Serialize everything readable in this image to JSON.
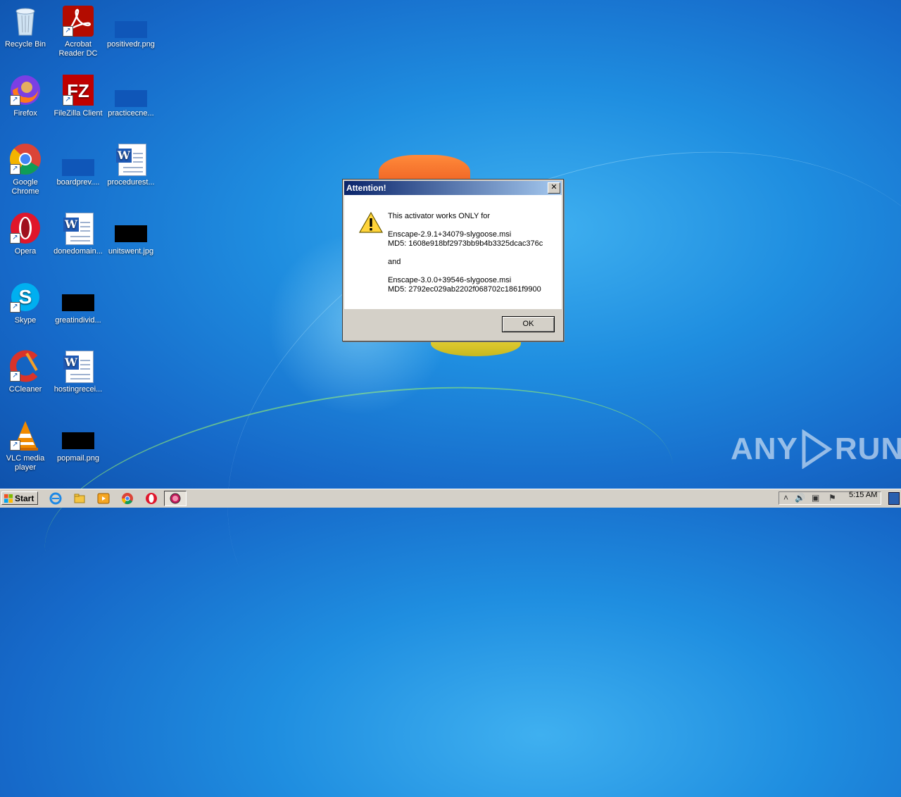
{
  "desktop": {
    "icons": [
      {
        "label": "Recycle Bin"
      },
      {
        "label": "Acrobat Reader DC"
      },
      {
        "label": "positivedr.png"
      },
      {
        "label": "Firefox"
      },
      {
        "label": "FileZilla Client"
      },
      {
        "label": "practicecne..."
      },
      {
        "label": "Google Chrome"
      },
      {
        "label": "boardprev...."
      },
      {
        "label": "procedurest..."
      },
      {
        "label": "Opera"
      },
      {
        "label": "donedomain..."
      },
      {
        "label": "unitswent.jpg"
      },
      {
        "label": "Skype"
      },
      {
        "label": "greatindivid..."
      },
      {
        "label": "CCleaner"
      },
      {
        "label": "hostingrecei..."
      },
      {
        "label": "VLC media player"
      },
      {
        "label": "popmail.png"
      }
    ]
  },
  "dialog": {
    "title": "Attention!",
    "close_label": "✕",
    "message": "This activator works ONLY for\n\nEnscape-2.9.1+34079-slygoose.msi\nMD5: 1608e918bf2973bb9b4b3325dcac376c\n\nand\n\nEnscape-3.0.0+39546-slygoose.msi\nMD5: 2792ec029ab2202f068702c1861f9900",
    "ok_label": "OK",
    "icon": "warning-icon"
  },
  "watermark": {
    "left": "ANY",
    "right": "RUN"
  },
  "taskbar": {
    "start_label": "Start",
    "clock": "5:15 AM",
    "pinned": [
      "internet-explorer-icon",
      "explorer-icon",
      "media-player-icon",
      "chrome-icon",
      "opera-icon",
      "active-app-icon"
    ]
  }
}
